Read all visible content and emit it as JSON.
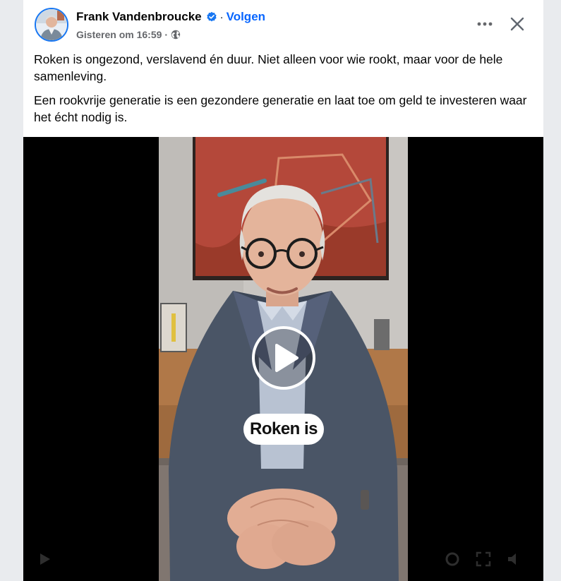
{
  "post": {
    "author": "Frank Vandenbroucke",
    "separator": "·",
    "follow_label": "Volgen",
    "timestamp": "Gisteren om 16:59",
    "meta_separator": "·",
    "paragraphs": [
      "Roken is ongezond, verslavend én duur. Niet alleen voor wie rookt, maar voor de hele samenleving.",
      "Een rookvrije generatie is een gezondere generatie en laat toe om geld te investeren waar het écht nodig is."
    ]
  },
  "video": {
    "caption": "Roken is"
  },
  "icons": {
    "verified": "verified-badge-icon",
    "audience": "globe-icon",
    "more": "more-options-icon",
    "close": "close-icon",
    "play": "play-icon"
  },
  "colors": {
    "accent": "#0866ff",
    "verified": "#1877f2",
    "muted_text": "#65676b",
    "video_background": "#000000"
  }
}
